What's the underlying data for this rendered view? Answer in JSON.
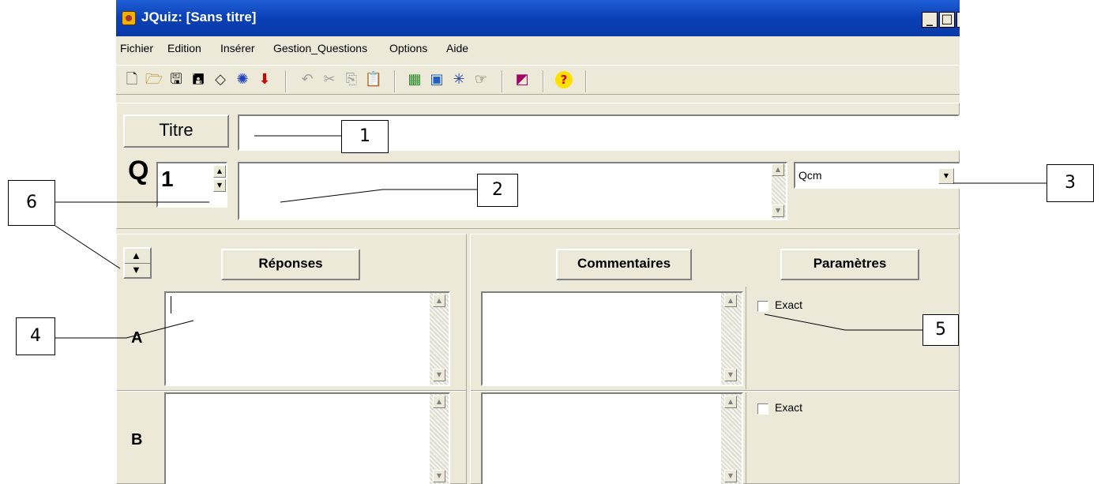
{
  "window": {
    "title": "JQuiz: [Sans titre]",
    "controls": {
      "minimize": "_",
      "maximize": "□"
    }
  },
  "menu": [
    "Fichier",
    "Edition",
    "Insérer",
    "Gestion_Questions",
    "Options",
    "Aide"
  ],
  "toolbar": {
    "icons": [
      "new-file-icon",
      "open-folder-icon",
      "save-icon",
      "save-as-icon",
      "clear-icon",
      "add-icon",
      "export-icon",
      "undo-icon",
      "cut-icon",
      "copy-icon",
      "paste-icon",
      "image-icon",
      "picture-icon",
      "spider-icon",
      "hand-icon",
      "settings-icon",
      "help-icon"
    ],
    "help_glyph": "?"
  },
  "title_section": {
    "button_label": "Titre",
    "value": ""
  },
  "question": {
    "prefix": "Q",
    "number": "1",
    "text": "",
    "type": "Qcm"
  },
  "headers": {
    "responses": "Réponses",
    "comments": "Commentaires",
    "parameters": "Paramètres"
  },
  "answers": [
    {
      "letter": "A",
      "text": "",
      "comment": "",
      "exact_label": "Exact",
      "exact": false
    },
    {
      "letter": "B",
      "text": "",
      "comment": "",
      "exact_label": "Exact",
      "exact": false
    }
  ],
  "callouts": [
    "1",
    "2",
    "3",
    "4",
    "5",
    "6"
  ]
}
